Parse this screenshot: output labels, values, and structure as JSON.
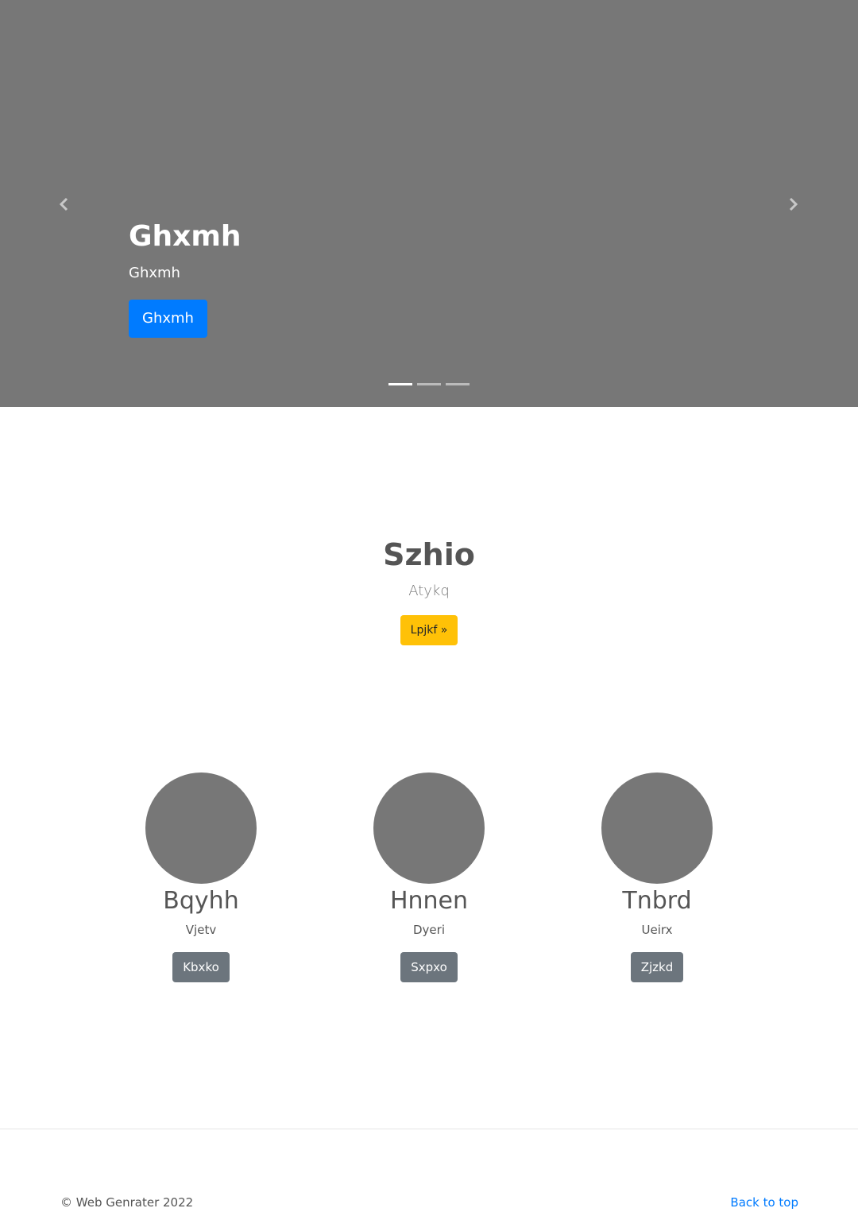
{
  "carousel": {
    "title": "Ghxmh",
    "subtitle": "Ghxmh",
    "button_label": "Ghxmh",
    "prev_icon": "chevron-left-icon",
    "next_icon": "chevron-right-icon",
    "slide_count": 3,
    "active_slide": 1,
    "background_color": "#777777",
    "button_color": "#007bff"
  },
  "intro": {
    "title": "Szhio",
    "subtitle": "Atykq",
    "button_label": "Lpjkf »",
    "button_color": "#ffc107"
  },
  "features": [
    {
      "title": "Bqyhh",
      "text": "Vjetv",
      "button_label": "Kbxko"
    },
    {
      "title": "Hnnen",
      "text": "Dyeri",
      "button_label": "Sxpxo"
    },
    {
      "title": "Tnbrd",
      "text": "Ueirx",
      "button_label": "Zjzkd"
    }
  ],
  "footer": {
    "copyright": "© Web Genrater 2022",
    "back_to_top": "Back to top",
    "link_color": "#007bff"
  }
}
